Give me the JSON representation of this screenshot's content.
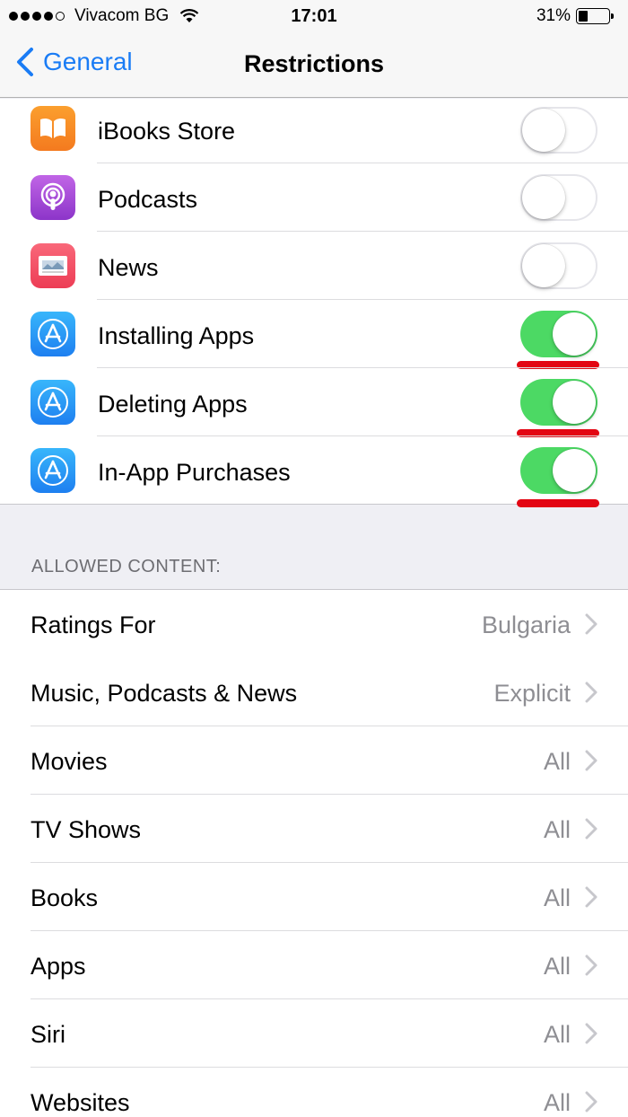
{
  "status_bar": {
    "carrier": "Vivacom BG",
    "time": "17:01",
    "battery": "31%",
    "battery_level": 0.31
  },
  "nav": {
    "back_label": "General",
    "title": "Restrictions"
  },
  "toggles": [
    {
      "label": "iBooks Store",
      "on": false,
      "icon": "ibooks-store-icon",
      "color": "#f7931e"
    },
    {
      "label": "Podcasts",
      "on": false,
      "icon": "podcasts-icon",
      "color": "#a345d4"
    },
    {
      "label": "News",
      "on": false,
      "icon": "news-icon",
      "color": "#f0455a"
    },
    {
      "label": "Installing Apps",
      "on": true,
      "icon": "app-store-icon",
      "color": "#1e9af3",
      "highlighted": true
    },
    {
      "label": "Deleting Apps",
      "on": true,
      "icon": "app-store-icon",
      "color": "#1e9af3",
      "highlighted": true
    },
    {
      "label": "In-App Purchases",
      "on": true,
      "icon": "app-store-icon",
      "color": "#1e9af3",
      "highlighted": true
    }
  ],
  "allowed_content": {
    "header": "ALLOWED CONTENT:",
    "items": [
      {
        "label": "Ratings For",
        "value": "Bulgaria"
      },
      {
        "label": "Music, Podcasts & News",
        "value": "Explicit"
      },
      {
        "label": "Movies",
        "value": "All"
      },
      {
        "label": "TV Shows",
        "value": "All"
      },
      {
        "label": "Books",
        "value": "All"
      },
      {
        "label": "Apps",
        "value": "All"
      },
      {
        "label": "Siri",
        "value": "All"
      },
      {
        "label": "Websites",
        "value": "All"
      }
    ]
  },
  "colors": {
    "accent": "#1a7cf5",
    "toggle_on": "#4cd964",
    "highlight": "#e30613"
  }
}
